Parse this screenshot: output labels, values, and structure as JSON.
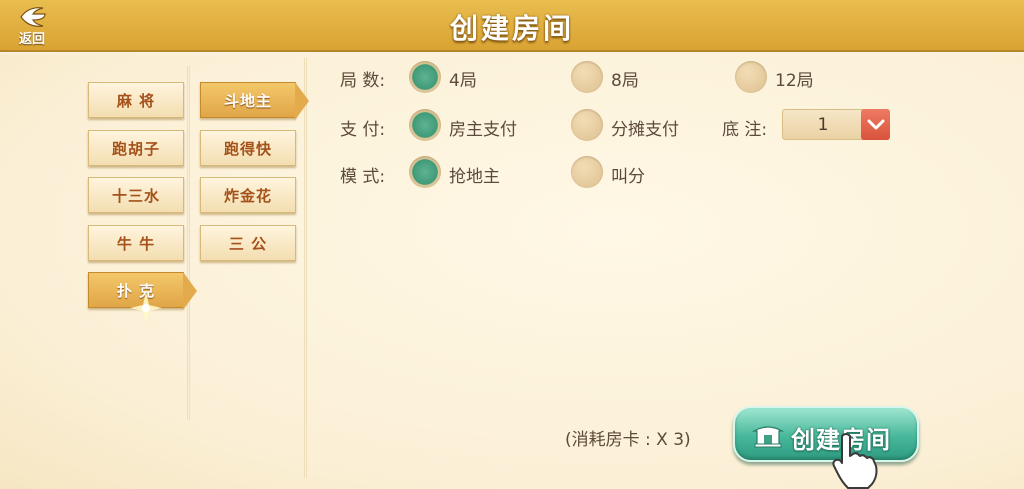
{
  "header": {
    "back_label": "返回",
    "title": "创建房间"
  },
  "categories_left": [
    {
      "label": "麻 将",
      "active": false
    },
    {
      "label": "跑胡子",
      "active": false
    },
    {
      "label": "十三水",
      "active": false
    },
    {
      "label": "牛 牛",
      "active": false
    },
    {
      "label": "扑 克",
      "active": true
    }
  ],
  "categories_right": [
    {
      "label": "斗地主",
      "active": true
    },
    {
      "label": "跑得快",
      "active": false
    },
    {
      "label": "炸金花",
      "active": false
    },
    {
      "label": "三 公",
      "active": false
    }
  ],
  "options": {
    "rounds": {
      "label": "局 数:",
      "choices": [
        {
          "text": "4局",
          "selected": true
        },
        {
          "text": "8局",
          "selected": false
        },
        {
          "text": "12局",
          "selected": false
        }
      ]
    },
    "payment": {
      "label": "支 付:",
      "choices": [
        {
          "text": "房主支付",
          "selected": true
        },
        {
          "text": "分摊支付",
          "selected": false
        }
      ]
    },
    "base_bet": {
      "label": "底 注:",
      "value": "1"
    },
    "mode": {
      "label": "模 式:",
      "choices": [
        {
          "text": "抢地主",
          "selected": true
        },
        {
          "text": "叫分",
          "selected": false
        }
      ]
    }
  },
  "footer": {
    "cost_text": "(消耗房卡 : X 3)",
    "create_label": "创建房间"
  },
  "colors": {
    "header": "#dca838",
    "selected_radio": "#3f9a78",
    "create_button": "#47b79a",
    "category_text": "#a4511a"
  }
}
